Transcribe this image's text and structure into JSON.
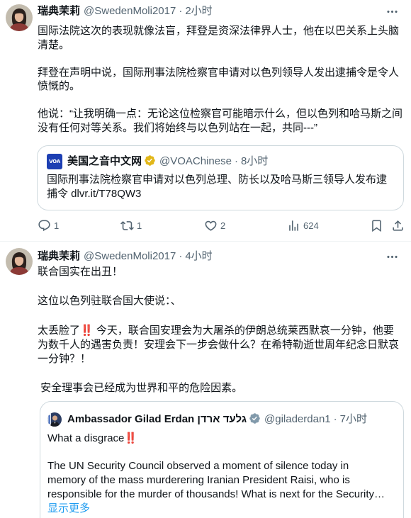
{
  "colors": {
    "text": "#0f1419",
    "secondary_text": "#536471",
    "link": "#1d9bf0",
    "card_border": "#cfd9de",
    "divider": "#eff3f4",
    "verified_gold": "#e2b719",
    "verified_gray": "#829aab",
    "emoji_red": "#e0162b",
    "voa_blue": "#1d3fb3"
  },
  "tweets": [
    {
      "author": {
        "name": "瑞典茉莉",
        "handle": "@SwedenMoli2017",
        "avatar_icon": "user-avatar"
      },
      "separator": "·",
      "time": "2小时",
      "more_icon": "more-icon",
      "paragraphs": [
        [
          "国际法院这次的表现就像法盲，拜登是资深法律界人士，他在以巴关系上头脑",
          "清楚。"
        ],
        [
          "拜登在声明中说，国际刑事法院检察官申请对以色列领导人发出逮捕令是令人",
          "愤慨的。"
        ],
        [
          "他说：“让我明确一点：无论这位检察官可能暗示什么，但以色列和哈马斯之间",
          "没有任何对等关系。我们将始终与以色列站在一起，共同---”"
        ]
      ],
      "quote": {
        "author": {
          "name": "美国之音中文网",
          "handle": "@VOAChinese",
          "logo_text": "VOA",
          "badge_icon": "verified-gold-icon"
        },
        "separator": "·",
        "time": "8小时",
        "lines": [
          "国际刑事法院检察官申请对以色列总理、防长以及哈马斯三领导人发布逮",
          "捕令 dlvr.it/T78QW3"
        ]
      },
      "actions": {
        "reply": {
          "icon": "reply-icon",
          "count": "1"
        },
        "retweet": {
          "icon": "retweet-icon",
          "count": "1"
        },
        "like": {
          "icon": "heart-icon",
          "count": "2"
        },
        "views": {
          "icon": "views-icon",
          "count": "624"
        },
        "bookmark": {
          "icon": "bookmark-icon"
        },
        "share": {
          "icon": "share-icon"
        }
      }
    },
    {
      "author": {
        "name": "瑞典茉莉",
        "handle": "@SwedenMoli2017",
        "avatar_icon": "user-avatar"
      },
      "separator": "·",
      "time": "4小时",
      "more_icon": "more-icon",
      "paragraphs": [
        [
          "联合国实在出丑！"
        ],
        [
          "这位以色列驻联合国大使说：、"
        ],
        [
          {
            "text": "太丢脸了",
            "emoji": "‼️",
            "after": " 今天，联合国安理会为大屠杀的伊朗总统莱西默哀一分钟，他要"
          },
          "为数千人的遇害负责！安理会下一步会做什么？在希特勒逝世周年纪念日默哀",
          "一分钟？！"
        ],
        [
          " 安全理事会已经成为世界和平的危险因素。"
        ]
      ],
      "quote": {
        "author": {
          "name": "Ambassador Gilad Erdan גלעד ארדן",
          "handle": "@giladerdan1",
          "badge_icon": "verified-gray-icon"
        },
        "separator": "·",
        "time": "7小时",
        "paragraphs": [
          [
            {
              "text": "What a disgrace",
              "emoji": "‼️"
            }
          ],
          [
            "The UN Security Council observed a moment of silence today in",
            "memory of the mass murderering Iranian President Raisi, who is",
            "responsible for the murder of thousands! What is next for the Security…"
          ]
        ],
        "show_more": "显示更多"
      }
    }
  ]
}
